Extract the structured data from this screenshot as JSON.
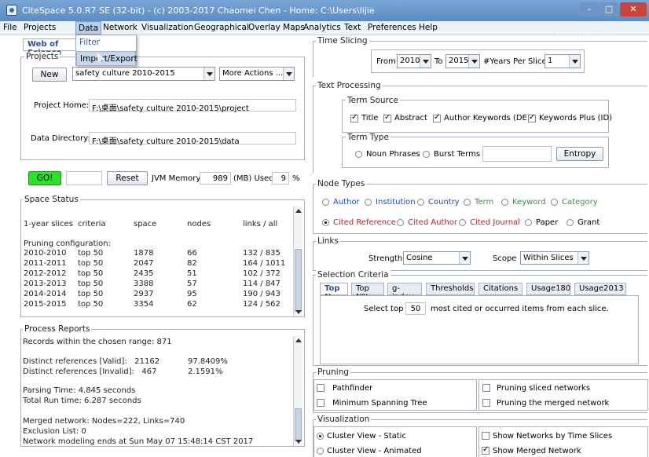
{
  "window": {
    "title": "CiteSpace 5.0.R7 SE (32-bit) - (c) 2003-2017 Chaomei Chen - Home: C:\\Users\\lijie",
    "min": "–",
    "max": "□",
    "close": "✕",
    "watermark": "bandle.sa"
  },
  "menubar": [
    "File",
    "Projects",
    "Data",
    "Network",
    "Visualization",
    "Geographical",
    "Overlay Maps",
    "Analytics",
    "Text",
    "Preferences",
    "Help"
  ],
  "data_menu": [
    "Filter",
    "Import/Export"
  ],
  "left_tab": "Web of Science",
  "projects": {
    "title": "Projects",
    "new_label": "New",
    "project_select": "safety culture 2010-2015",
    "more_actions": "More Actions ...",
    "home_label": "Project Home:",
    "home_value": "F:\\桌面\\safety culture 2010-2015\\project",
    "data_label": "Data Directory:",
    "data_value": "F:\\桌面\\safety culture 2010-2015\\data"
  },
  "run": {
    "go_label": "GO!",
    "reset_label": "Reset",
    "jvm_label": "JVM Memory",
    "jvm_value": "989",
    "mb_used_label": "(MB) Used",
    "used_value": "9",
    "percent": "%"
  },
  "space_status": {
    "title": "Space Status",
    "headers": [
      "1-year slices",
      "criteria",
      "space",
      "nodes",
      "links / all"
    ],
    "pruning": "Pruning configuration:",
    "rows": [
      [
        "2010-2010",
        "top 50",
        "1878",
        "66",
        "132 / 835"
      ],
      [
        "2011-2011",
        "top 50",
        "2047",
        "82",
        "164 / 1011"
      ],
      [
        "2012-2012",
        "top 50",
        "2435",
        "51",
        "102 / 372"
      ],
      [
        "2013-2013",
        "top 50",
        "3388",
        "57",
        "114 / 847"
      ],
      [
        "2014-2014",
        "top 50",
        "2937",
        "95",
        "190 / 943"
      ],
      [
        "2015-2015",
        "top 50",
        "3354",
        "62",
        "124 / 562"
      ]
    ]
  },
  "process_reports": {
    "title": "Process Reports",
    "lines": [
      "Records within the chosen range: 871",
      "",
      "Distinct references [Valid]: 21162    97.8409%",
      "Distinct references [Invalid]: 467    2.1591%",
      "",
      "Parsing Time: 4.845 seconds",
      "Total Run time: 6.287 seconds",
      "",
      "Merged network: Nodes=222, Links=740",
      "Exclusion List: 0",
      "Network modeling ends at Sun May 07 15:48:14 CST 2017"
    ]
  },
  "time_slicing": {
    "title": "Time Slicing",
    "from_label": "From",
    "from_value": "2010",
    "to_label": "To",
    "to_value": "2015",
    "years_label": "#Years Per Slice",
    "years_value": "1"
  },
  "text_processing": {
    "title": "Text Processing",
    "term_source_title": "Term Source",
    "sources": [
      "Title",
      "Abstract",
      "Author Keywords (DE)",
      "Keywords Plus (ID)"
    ],
    "term_type_title": "Term Type",
    "types": [
      "Noun Phrases",
      "Burst Terms"
    ],
    "entropy_label": "Entropy"
  },
  "node_types": {
    "title": "Node Types",
    "row1": [
      "Author",
      "Institution",
      "Country",
      "Term",
      "Keyword",
      "Category"
    ],
    "row2": [
      "Cited Reference",
      "Cited Author",
      "Cited Journal",
      "Paper",
      "Grant"
    ]
  },
  "links": {
    "title": "Links",
    "strength_label": "Strength",
    "strength_value": "Cosine",
    "scope_label": "Scope",
    "scope_value": "Within Slices"
  },
  "selection": {
    "title": "Selection Criteria",
    "tabs": [
      "Top N",
      "Top N%",
      "g-index",
      "Thresholds",
      "Citations",
      "Usage180",
      "Usage2013"
    ],
    "select_top_label": "Select top",
    "select_top_value": "50",
    "suffix": "most cited or occurred items from each slice."
  },
  "pruning": {
    "title": "Pruning",
    "options": [
      "Pathfinder",
      "Pruning sliced networks",
      "Minimum Spanning Tree",
      "Pruning the merged network"
    ]
  },
  "visualization": {
    "title": "Visualization",
    "options": [
      "Cluster View - Static",
      "Show Networks by Time Slices",
      "Cluster View - Animated",
      "Show Merged Network"
    ]
  }
}
